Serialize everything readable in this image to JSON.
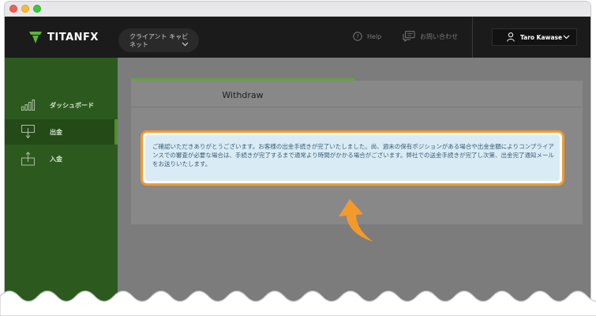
{
  "app": {
    "logo_text": "TITANFX",
    "client_selector": "クライアント キャビネット",
    "help_label": "Help",
    "contact_label": "お問い合わせ",
    "user_name": "Taro Kawase"
  },
  "sidebar": {
    "items": [
      {
        "label": "ダッシュボード",
        "icon": "bar-chart-icon",
        "active": false
      },
      {
        "label": "出金",
        "icon": "withdraw-icon",
        "active": true
      },
      {
        "label": "入金",
        "icon": "deposit-icon",
        "active": false
      }
    ]
  },
  "main": {
    "tab_label": "Withdraw",
    "notice": "ご確認いただきありがとうございます。お客様の出金手続きが完了いたしました。尚、週末の保有ポジションがある場合や出金金額によりコンプライアンスでの審査が必要な場合は、手続きが完了するまで通常より時間がかかる場合がございます。弊社での送金手続きが完了し次第、出金完了通知メールをお送りいたします。"
  },
  "colors": {
    "accent_green": "#64a43c",
    "sidebar_green": "#2c5a1e",
    "highlight_orange": "#f39a2b",
    "notice_bg": "#d9ecf6"
  }
}
